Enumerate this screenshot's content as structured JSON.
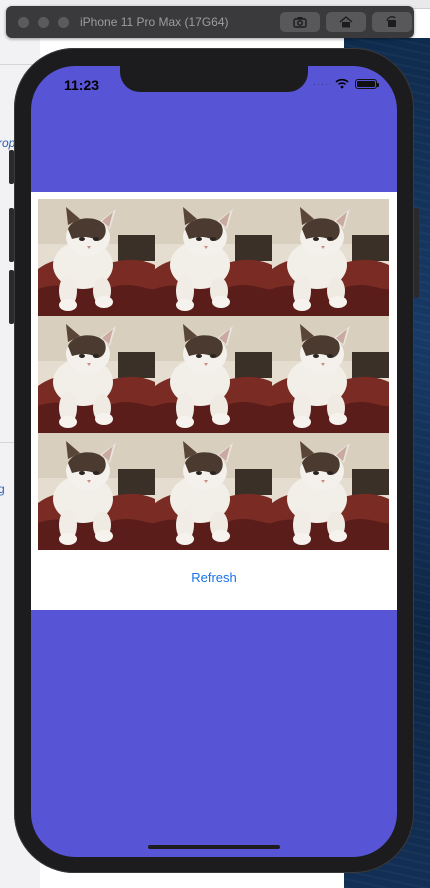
{
  "simulator": {
    "device_name": "iPhone 11 Pro Max (17G64)",
    "buttons": [
      {
        "icon": "screenshot-icon"
      },
      {
        "icon": "home-icon"
      },
      {
        "icon": "rotate-icon"
      }
    ]
  },
  "status_bar": {
    "time": "11:23",
    "icons": [
      "signal-icon",
      "wifi-icon",
      "battery-icon"
    ]
  },
  "background_window": {
    "fragment_1": "rop",
    "fragment_2": "g"
  },
  "app": {
    "background_color": "#5854d6",
    "image_grid": {
      "rows": 3,
      "columns": 3,
      "image_subject": "cat"
    },
    "refresh_label": "Refresh",
    "accent_color": "#1a73e8"
  }
}
